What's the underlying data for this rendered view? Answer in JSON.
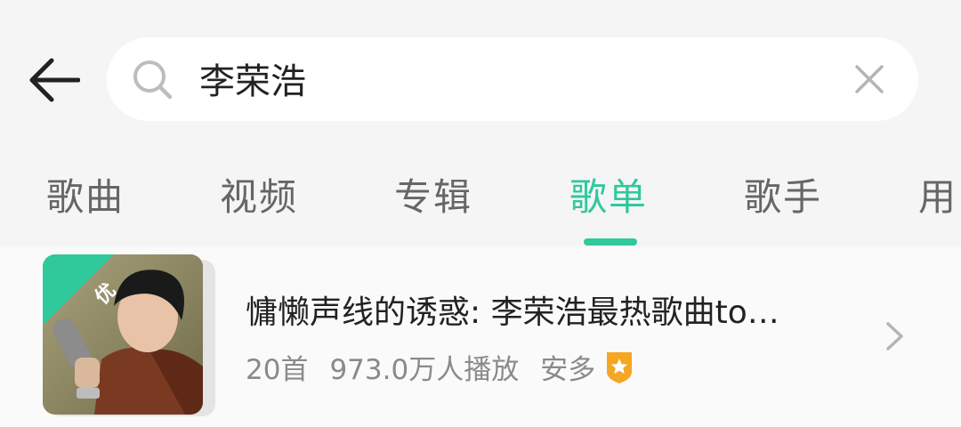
{
  "colors": {
    "accent": "#2fc99b",
    "background": "#f5f5f5",
    "search_bg": "#ffffff",
    "tab_text": "#666666",
    "title_text": "#222222",
    "meta_text": "#8a8a8a",
    "vip_badge": "#f5a623"
  },
  "header": {
    "back_icon": "arrow-left-icon",
    "search": {
      "icon": "search-icon",
      "value": "李荣浩",
      "clear_icon": "close-icon"
    }
  },
  "tabs": [
    {
      "label": "歌曲",
      "active": false
    },
    {
      "label": "视频",
      "active": false
    },
    {
      "label": "专辑",
      "active": false
    },
    {
      "label": "歌单",
      "active": true
    },
    {
      "label": "歌手",
      "active": false
    },
    {
      "label": "用",
      "active": false
    }
  ],
  "results": [
    {
      "cover_badge": "优",
      "title": "慵懒声线的诱惑: 李荣浩最热歌曲to…",
      "count": "20首",
      "plays": "973.0万人播放",
      "author": "安多",
      "author_badge_icon": "vip-star-badge-icon",
      "arrow_icon": "chevron-right-icon"
    }
  ]
}
